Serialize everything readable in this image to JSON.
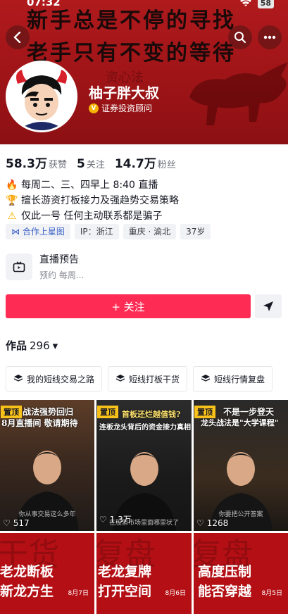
{
  "status": {
    "time": "07:32",
    "battery": "58"
  },
  "banner": {
    "line1": "新手总是不停的寻找",
    "line2": "老手只有不变的等待",
    "faint": "资心法"
  },
  "profile": {
    "nickname": "柚子胖大叔",
    "verify_badge": "V",
    "verify_text": "证券投资顾问"
  },
  "stats": [
    {
      "value": "58.3万",
      "label": "获赞"
    },
    {
      "value": "5",
      "label": "关注"
    },
    {
      "value": "14.7万",
      "label": "粉丝"
    }
  ],
  "bio": [
    {
      "icon": "fire-icon",
      "glyph": "🔥",
      "text": "每周二、三、四早上 8:40 直播"
    },
    {
      "icon": "trophy-icon",
      "glyph": "🏆",
      "text": "擅长游资打板接力及强趋势交易策略"
    },
    {
      "icon": "warning-icon",
      "glyph": "⚠",
      "text": "仅此一号 任何主动联系都是骗子"
    }
  ],
  "tags": {
    "collab": "合作上星图",
    "ip": "IP：浙江",
    "location": "重庆 · 渝北",
    "age": "37岁"
  },
  "live": {
    "title": "直播预告",
    "subtitle": "预约 每周..."
  },
  "actions": {
    "follow": "+ 关注"
  },
  "works": {
    "label": "作品",
    "count": "296"
  },
  "collections": [
    "我的短线交易之路",
    "短线打板干货",
    "短线行情复盘"
  ],
  "videos": [
    {
      "pin": "置顶",
      "cap1": "战法强势回归",
      "cap2": "8月直播间 敬请期待",
      "likes": "517",
      "sub": "你从事交易这么多年"
    },
    {
      "pin": "置顶",
      "cap1": "首板还烂越值钱?",
      "cap2": "连板龙头背后的资金接力真相",
      "likes": "1.3万",
      "sub": "在股票市场里面哪里状了"
    },
    {
      "pin": "置顶",
      "cap1": "不是一步登天",
      "cap2": "龙头战法是\"大学课程\"",
      "likes": "1268",
      "sub": "你要把公开答案"
    }
  ],
  "red_videos": [
    {
      "line1": "老龙断板",
      "line2": "新龙方生",
      "date": "8月7日",
      "bg": "干货"
    },
    {
      "line1": "老龙复牌",
      "line2": "打开空间",
      "date": "8月6日",
      "bg": "复盘"
    },
    {
      "line1": "高度压制",
      "line2": "能否穿越",
      "date": "8月5日",
      "bg": "复盘"
    }
  ],
  "colors": {
    "accent": "#fe2c55",
    "banner": "#a5171a",
    "pin": "#f9c21a"
  }
}
